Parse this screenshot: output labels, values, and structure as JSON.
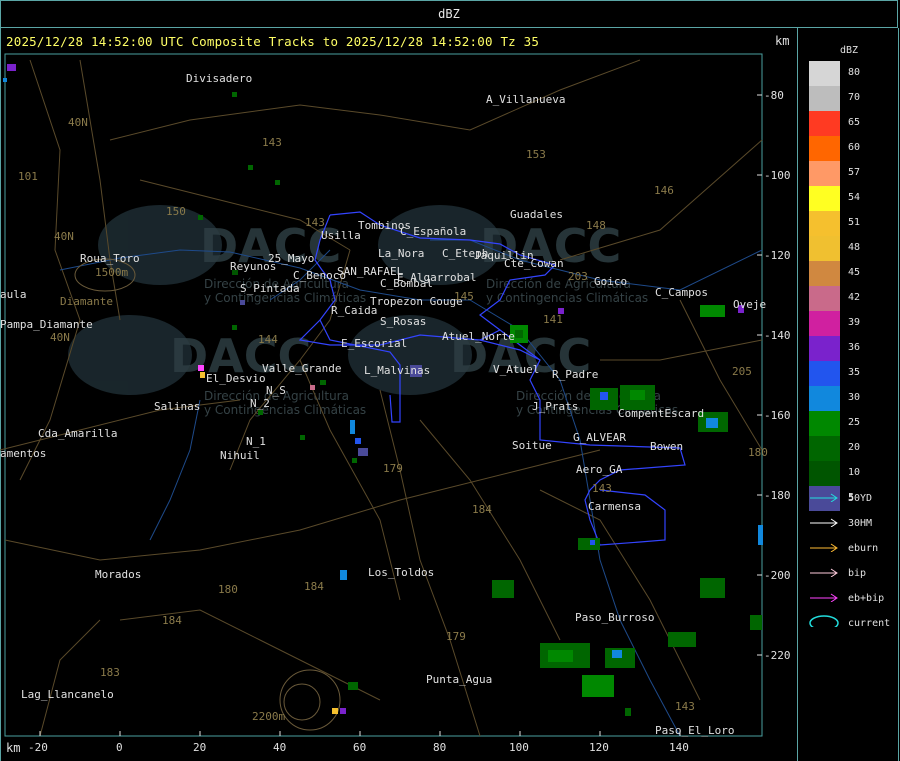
{
  "header": {
    "title": "dBZ"
  },
  "map": {
    "subtitle": "2025/12/28 14:52:00 UTC Composite Tracks to 2025/12/28 14:52:00 Tz 35",
    "km_label_top": "km",
    "km_label_bottom": "km",
    "x_axis_labels": [
      "-20",
      "0",
      "20",
      "40",
      "60",
      "80",
      "100",
      "120",
      "140"
    ],
    "y_axis_labels": [
      "-80",
      "-100",
      "-120",
      "-140",
      "-160",
      "-180",
      "-200",
      "-220"
    ],
    "watermark_text": "DACC",
    "watermark_sub1": "Dirección de Agricultura",
    "watermark_sub2": "y Contingencias Climáticas",
    "places": [
      "Divisadero",
      "A_Villanueva",
      "Guadales",
      "Tombinos",
      "Usilla",
      "C_Española",
      "Roua_Toro",
      "La_Nora",
      "C_Eteph",
      "Jaquillin",
      "Reyunos",
      "25_Mayo",
      "C_Benoco",
      "SAN_RAFAEL",
      "E_Algarrobal",
      "Cte_Cowan",
      "Goico",
      "C_Campos",
      "Pampa_Diamante",
      "S_Pintada",
      "C_Bombal",
      "Tropezon Gouge",
      "R_Caida",
      "S_Rosas",
      "Atuel_Norte",
      "E_Escorial",
      "Valle_Grande",
      "L_Malvinas",
      "V_Atuel",
      "R_Padre",
      "El_Desvio",
      "Salinas",
      "N_2",
      "N_S",
      "J_Prats",
      "CompentEscard",
      "Cda_Amarilla",
      "N_1",
      "Nihuil",
      "G_ALVEAR",
      "Bowen",
      "Soitue",
      "amentos",
      "Aero_GA",
      "Carmensa",
      "Morados",
      "Los_Toldos",
      "Paso_Burroso",
      "Lag_Llancanelo",
      "Punta_Agua",
      "Paso_El_Loro",
      "Oveje",
      "aula",
      "1500m",
      "2200m",
      "Diamante"
    ],
    "roads": [
      "143",
      "153",
      "146",
      "148",
      "150",
      "40N",
      "101",
      "40N",
      "40N",
      "144",
      "145",
      "143",
      "141",
      "203",
      "179",
      "184",
      "180",
      "184",
      "179",
      "184",
      "183",
      "143",
      "205",
      "180",
      "143"
    ]
  },
  "legend": {
    "title": "dBZ",
    "scale": [
      {
        "value": "80",
        "color": "#d6d6d6"
      },
      {
        "value": "70",
        "color": "#bdbdbd"
      },
      {
        "value": "65",
        "color": "#ff3a22"
      },
      {
        "value": "60",
        "color": "#ff6600"
      },
      {
        "value": "57",
        "color": "#ff9966"
      },
      {
        "value": "54",
        "color": "#ffff22"
      },
      {
        "value": "51",
        "color": "#f5c02e"
      },
      {
        "value": "48",
        "color": "#f0c030"
      },
      {
        "value": "45",
        "color": "#d08840"
      },
      {
        "value": "42",
        "color": "#c96a8a"
      },
      {
        "value": "39",
        "color": "#d020a0"
      },
      {
        "value": "36",
        "color": "#7a22cc"
      },
      {
        "value": "35",
        "color": "#2255ee"
      },
      {
        "value": "30",
        "color": "#1188dd"
      },
      {
        "value": "25",
        "color": "#008800"
      },
      {
        "value": "20",
        "color": "#006600"
      },
      {
        "value": "10",
        "color": "#005500"
      },
      {
        "value": "5",
        "color": "#4a4a99"
      }
    ],
    "tracks": [
      {
        "label": "50YD",
        "color": "#22dddd"
      },
      {
        "label": "30HM",
        "color": "#ffffff"
      },
      {
        "label": "eburn",
        "color": "#ffbb33"
      },
      {
        "label": "bip",
        "color": "#ffccdd"
      },
      {
        "label": "eb+bip",
        "color": "#ff44ff"
      },
      {
        "label": "current",
        "color": "#22dddd"
      }
    ]
  }
}
